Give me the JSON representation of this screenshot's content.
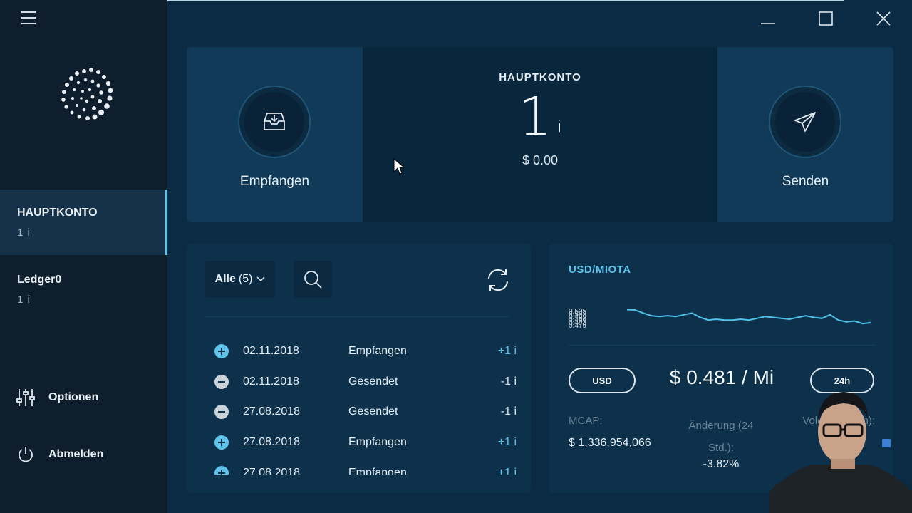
{
  "sidebar": {
    "accounts": [
      {
        "name": "HAUPTKONTO",
        "balance": "1 i",
        "active": true
      },
      {
        "name": "Ledger0",
        "balance": "1 i",
        "active": false
      }
    ],
    "options_label": "Optionen",
    "logout_label": "Abmelden"
  },
  "hero": {
    "receive_label": "Empfangen",
    "send_label": "Senden",
    "account_title": "HAUPTKONTO",
    "balance_value": "1",
    "balance_unit": "i",
    "balance_usd": "$ 0.00"
  },
  "transactions": {
    "filter_label": "Alle",
    "filter_count": "(5)",
    "rows": [
      {
        "kind": "plus",
        "date": "02.11.2018",
        "type": "Empfangen",
        "value": "+1 i"
      },
      {
        "kind": "minus",
        "date": "02.11.2018",
        "type": "Gesendet",
        "value": "-1 i"
      },
      {
        "kind": "minus",
        "date": "27.08.2018",
        "type": "Gesendet",
        "value": "-1 i"
      },
      {
        "kind": "plus",
        "date": "27.08.2018",
        "type": "Empfangen",
        "value": "+1 i"
      },
      {
        "kind": "plus",
        "date": "27.08.2018",
        "type": "Empfangen",
        "value": "+1 i"
      }
    ]
  },
  "market": {
    "pair": "USD/MIOTA",
    "y_ticks": [
      "0.505",
      "0.502",
      "0.499",
      "0.496",
      "0.493",
      "0.479"
    ],
    "currency_button": "USD",
    "price": "$ 0.481 / Mi",
    "timeframe_button": "24h",
    "mcap_label": "MCAP:",
    "mcap_value": "$ 1,336,954,066",
    "change_label": "Änderung (24 Std.):",
    "change_value": "-3.82%",
    "volume_label": "Volumen (24h):"
  },
  "chart_data": {
    "type": "line",
    "title": "USD/MIOTA",
    "y_tick_labels": [
      "0.505",
      "0.502",
      "0.499",
      "0.496",
      "0.493",
      "0.479"
    ],
    "ylim": [
      0.479,
      0.505
    ],
    "series": [
      {
        "color": "#4fc3e9",
        "values": [
          0.503,
          0.5025,
          0.499,
          0.496,
          0.495,
          0.496,
          0.495,
          0.497,
          0.499,
          0.494,
          0.491,
          0.492,
          0.491,
          0.491,
          0.492,
          0.491,
          0.493,
          0.495,
          0.494,
          0.493,
          0.492,
          0.494,
          0.496,
          0.494,
          0.493,
          0.497,
          0.491,
          0.489,
          0.49,
          0.487,
          0.488
        ]
      }
    ]
  },
  "colors": {
    "accent": "#5ec3ea",
    "background": "#0a2b43",
    "sidebar": "#0e1e2c"
  }
}
